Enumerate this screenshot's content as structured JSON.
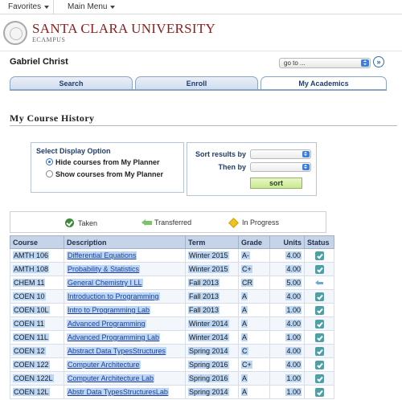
{
  "topbar": {
    "favorites": "Favorites",
    "main_menu": "Main Menu"
  },
  "brand": {
    "university": "SANTA CLARA UNIVERSITY",
    "subtitle": "ECAMPUS"
  },
  "user": {
    "name": "Gabriel Christ"
  },
  "goto": {
    "value": "go to ...",
    "button": "»"
  },
  "tabs": [
    {
      "label": "Search",
      "active": false
    },
    {
      "label": "Enroll",
      "active": false
    },
    {
      "label": "My Academics",
      "active": true
    }
  ],
  "page": {
    "title": "My Course History"
  },
  "display_option": {
    "heading": "Select Display Option",
    "options": [
      {
        "label": "Hide courses from My Planner",
        "selected": true
      },
      {
        "label": "Show courses from My Planner",
        "selected": false
      }
    ]
  },
  "sort": {
    "sort_by_label": "Sort results by",
    "then_by_label": "Then by",
    "sort_by_value": "",
    "then_by_value": "",
    "button": "sort"
  },
  "legend": {
    "taken": "Taken",
    "transferred": "Transferred",
    "in_progress": "In Progress"
  },
  "table": {
    "headers": [
      "Course",
      "Description",
      "Term",
      "Grade",
      "Units",
      "Status"
    ],
    "rows": [
      {
        "course": "AMTH 106",
        "description": "Differential Equations",
        "term": "Winter 2015",
        "grade": "A-",
        "units": "4.00",
        "status": "taken"
      },
      {
        "course": "AMTH 108",
        "description": "Probability & Statistics",
        "term": "Winter 2015",
        "grade": "C+",
        "units": "4.00",
        "status": "taken"
      },
      {
        "course": "CHEM 11",
        "description": "General Chemistry I LL",
        "term": "Fall 2013",
        "grade": "CR",
        "units": "5.00",
        "status": "transferred"
      },
      {
        "course": "COEN 10",
        "description": "Introduction to Programming",
        "term": "Fall 2013",
        "grade": "A",
        "units": "4.00",
        "status": "taken"
      },
      {
        "course": "COEN 10L",
        "description": "Intro to Programming Lab",
        "term": "Fall 2013",
        "grade": "A",
        "units": "1.00",
        "status": "taken"
      },
      {
        "course": "COEN 11",
        "description": "Advanced Programming",
        "term": "Winter 2014",
        "grade": "A",
        "units": "4.00",
        "status": "taken"
      },
      {
        "course": "COEN 11L",
        "description": "Advanced Programming Lab",
        "term": "Winter 2014",
        "grade": "A",
        "units": "1.00",
        "status": "taken"
      },
      {
        "course": "COEN 12",
        "description": "Abstract Data TypesStructures",
        "term": "Spring 2014",
        "grade": "C",
        "units": "4.00",
        "status": "taken"
      },
      {
        "course": "COEN 122",
        "description": "Computer Architecture",
        "term": "Spring 2016",
        "grade": "C+",
        "units": "4.00",
        "status": "taken"
      },
      {
        "course": "COEN 122L",
        "description": "Computer Architecture Lab",
        "term": "Spring 2016",
        "grade": "A",
        "units": "1.00",
        "status": "taken"
      },
      {
        "course": "COEN 12L",
        "description": "Abstr Data TypesStructuresLab",
        "term": "Spring 2014",
        "grade": "A",
        "units": "1.00",
        "status": "taken"
      }
    ]
  }
}
